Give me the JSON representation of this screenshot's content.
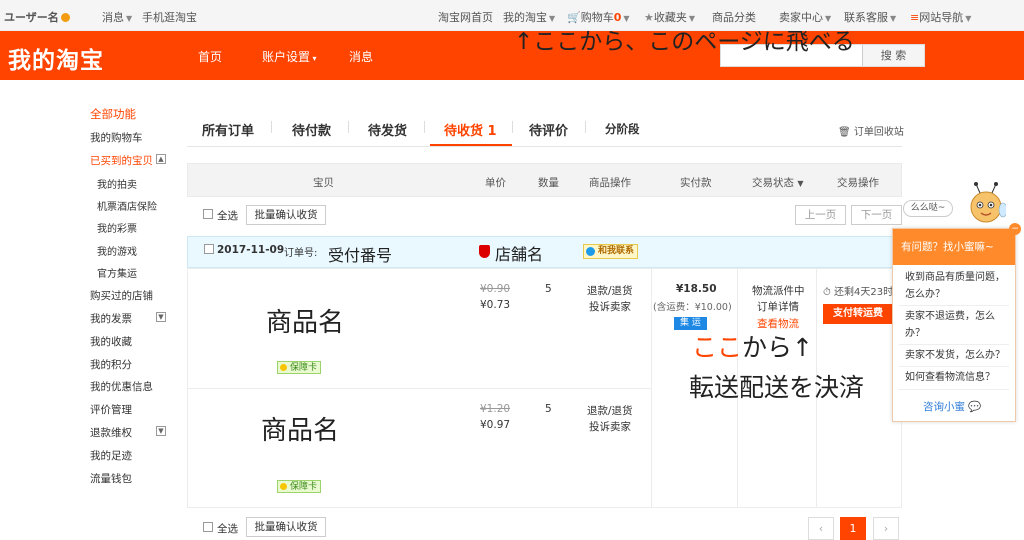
{
  "topbar": {
    "username": "ユーザー名",
    "messages": "消息",
    "mobile": "手机逛淘宝",
    "home": "淘宝网首页",
    "my_taobao": "我的淘宝",
    "cart": "购物车",
    "cart_count": "0",
    "favorites": "收藏夹",
    "categories": "商品分类",
    "seller_center": "卖家中心",
    "support": "联系客服",
    "site_nav": "网站导航"
  },
  "header": {
    "logo": "我的淘宝",
    "nav": [
      "首页",
      "账户设置",
      "消息"
    ],
    "search_button": "搜 索",
    "search_value": ""
  },
  "annotations": {
    "top": "↑ここから、このページに飛べる",
    "order_no": "受付番号",
    "shop": "店舗名",
    "product1": "商品名",
    "product2": "商品名",
    "pay1_a": "ここ",
    "pay1_b": "から↑",
    "pay2": "転送配送を決済"
  },
  "sidebar": {
    "all": "全部功能",
    "cart": "我的购物车",
    "bought": "已买到的宝贝",
    "subs": [
      "我的拍卖",
      "机票酒店保险",
      "我的彩票",
      "我的游戏",
      "官方集运"
    ],
    "shops": "购买过的店铺",
    "invoice": "我的发票",
    "collect": "我的收藏",
    "points": "我的积分",
    "coupons": "我的优惠信息",
    "review": "评价管理",
    "refund": "退款维权",
    "footprint": "我的足迹",
    "data": "流量钱包"
  },
  "tabs": [
    "所有订单",
    "待付款",
    "待发货",
    "待收货 1",
    "待评价",
    "分阶段"
  ],
  "recycle": "订单回收站",
  "thead": [
    "宝贝",
    "单价",
    "数量",
    "商品操作",
    "实付款",
    "交易状态",
    "交易操作"
  ],
  "toolbar": {
    "select_all": "全选",
    "batch_confirm": "批量确认收货",
    "prev": "上一页",
    "next": "下一页"
  },
  "order": {
    "date": "2017-11-09",
    "order_no_label": "订单号:",
    "contact": "和我联系",
    "items": [
      {
        "orig_price": "¥0.90",
        "price": "¥0.73",
        "qty": "5",
        "op1": "退款/退货",
        "op2": "投诉卖家",
        "guard": "保障卡"
      },
      {
        "orig_price": "¥1.20",
        "price": "¥0.97",
        "qty": "5",
        "op1": "退款/退货",
        "op2": "投诉卖家",
        "guard": "保障卡"
      }
    ],
    "total": "¥18.50",
    "shipping": "(含运费：¥10.00)",
    "ship_badge": "集 运",
    "status1": "物流派件中",
    "status2": "订单详情",
    "status3": "查看物流",
    "countdown": "还剩4天23时",
    "pay_button": "支付转运费"
  },
  "chat": {
    "bubble": "么么哒~",
    "title": "有问题？找小蜜嘛~",
    "questions": [
      "收到商品有质量问题，怎么办？",
      "卖家不退运费，怎么办？",
      "卖家不发货，怎么办？",
      "如何查看物流信息？"
    ],
    "consult": "咨询小蜜"
  },
  "pager": {
    "current": "1",
    "prev": "‹",
    "next": "›"
  }
}
